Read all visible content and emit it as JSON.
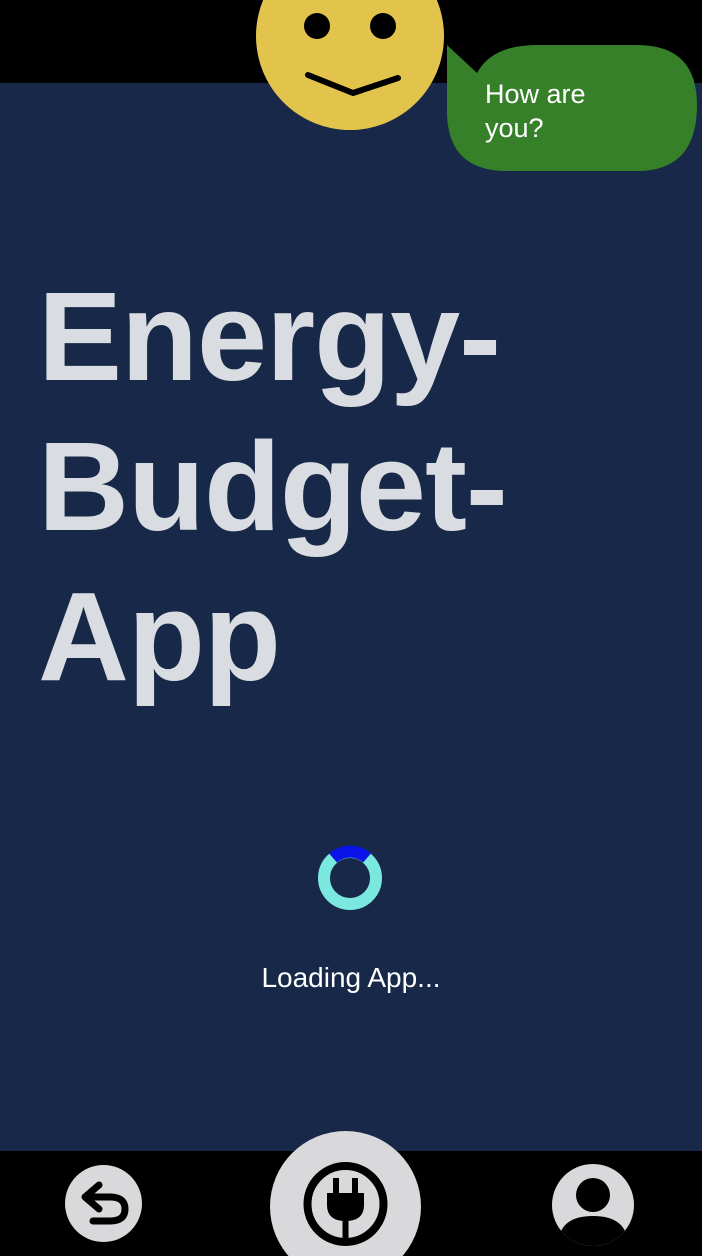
{
  "app": {
    "title_lines": [
      "Energy-",
      "Budget-",
      "App"
    ]
  },
  "mascot": {
    "icon": "smiley-face-icon",
    "bubble_text": "How are you?",
    "colors": {
      "face": "#e2c34c",
      "bubble": "#37802a"
    }
  },
  "loading": {
    "text": "Loading App...",
    "colors": {
      "ring": "#7ae8de",
      "arc": "#0a14e6"
    }
  },
  "nav": {
    "items": [
      {
        "name": "back",
        "icon": "undo-arrow-icon"
      },
      {
        "name": "energy",
        "icon": "power-plug-icon"
      },
      {
        "name": "profile",
        "icon": "user-avatar-icon"
      }
    ]
  },
  "colors": {
    "background": "#172848",
    "bars": "#000000",
    "title": "#d9dce1"
  }
}
